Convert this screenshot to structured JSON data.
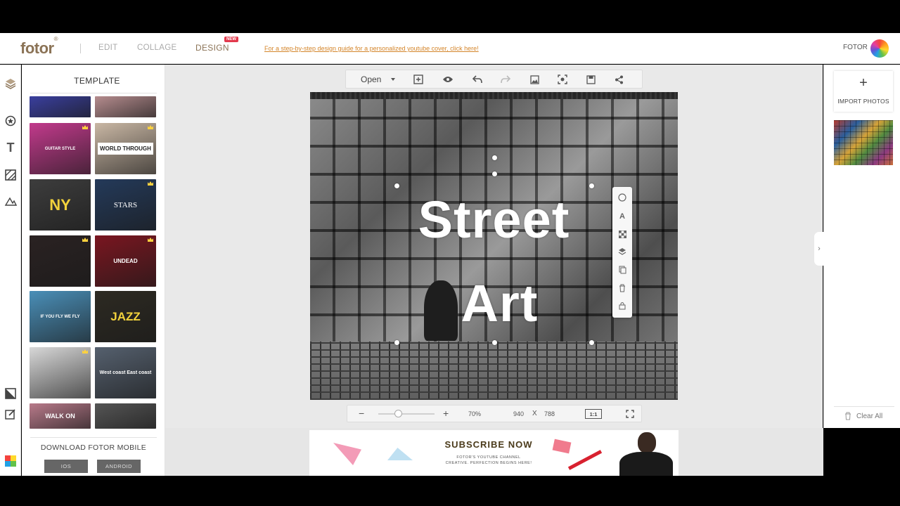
{
  "header": {
    "logo": "fotor",
    "logo_mark": "®",
    "nav": {
      "edit": "EDIT",
      "collage": "COLLAGE",
      "design": "DESIGN"
    },
    "new_badge": "NEW",
    "guide_link": "For a step-by-step design guide for a personalized youtube cover, click here!",
    "account_label": "FOTOR"
  },
  "tool_rail": [
    "layers-icon",
    "sticker-icon",
    "text-icon",
    "background-icon",
    "frame-icon",
    "crop-icon",
    "edit-icon",
    "color-palette-icon"
  ],
  "template_panel": {
    "title": "TEMPLATE",
    "thumbnails": [
      {
        "text": "",
        "bg": "#3a3f9e",
        "premium": false
      },
      {
        "text": "",
        "bg": "#b58c8e",
        "premium": false
      },
      {
        "text": "GUITAR STYLE",
        "bg": "#c23a8c",
        "premium": true
      },
      {
        "text": "WORLD THROUGH",
        "bg": "#c9b7a4",
        "premium": true
      },
      {
        "text": "NY",
        "bg": "#3d3d3d",
        "premium": false
      },
      {
        "text": "STARS",
        "bg": "#243a5a",
        "premium": true
      },
      {
        "text": "",
        "bg": "#2a2222",
        "premium": true
      },
      {
        "text": "UNDEAD",
        "bg": "#7a1620",
        "premium": true
      },
      {
        "text": "IF YOU FLY WE FLY",
        "bg": "#4a8fb8",
        "premium": false
      },
      {
        "text": "JAZZ",
        "bg": "#2d2a22",
        "premium": false
      },
      {
        "text": "",
        "bg": "#d8d8d8",
        "premium": true
      },
      {
        "text": "West coast East coast",
        "bg": "#55606e",
        "premium": false
      },
      {
        "text": "WALK ON",
        "bg": "#b87a8a",
        "premium": false
      },
      {
        "text": "",
        "bg": "#555555",
        "premium": false
      }
    ],
    "download_label": "DOWNLOAD FOTOR MOBILE",
    "ios_label": "IOS",
    "android_label": "ANDROID"
  },
  "toolbar": {
    "open_label": "Open",
    "icons": [
      "add-frame-icon",
      "eye-icon",
      "undo-icon",
      "redo-icon",
      "image-icon",
      "screenshot-icon",
      "save-icon",
      "share-icon"
    ]
  },
  "canvas": {
    "line1": "Street",
    "line2": "Art"
  },
  "float_tools": [
    "circle-icon",
    "text-icon",
    "transparency-icon",
    "layer-icon",
    "duplicate-icon",
    "delete-icon",
    "lock-icon"
  ],
  "zoom": {
    "percent": "70%",
    "width": "940",
    "x": "X",
    "height": "788",
    "ratio": "1:1",
    "level": 0.7
  },
  "right_panel": {
    "import_plus": "+",
    "import_label": "IMPORT PHOTOS",
    "clear_label": "Clear All"
  },
  "banner": {
    "title": "SUBSCRIBE NOW",
    "sub1": "FOTOR'S YOUTUBE CHANNEL",
    "sub2": "CREATIVE. PERFECTION BEGINS HERE!"
  },
  "colors": {
    "brand": "#8b7356",
    "link": "#d4852a",
    "badge": "#e2394c"
  }
}
